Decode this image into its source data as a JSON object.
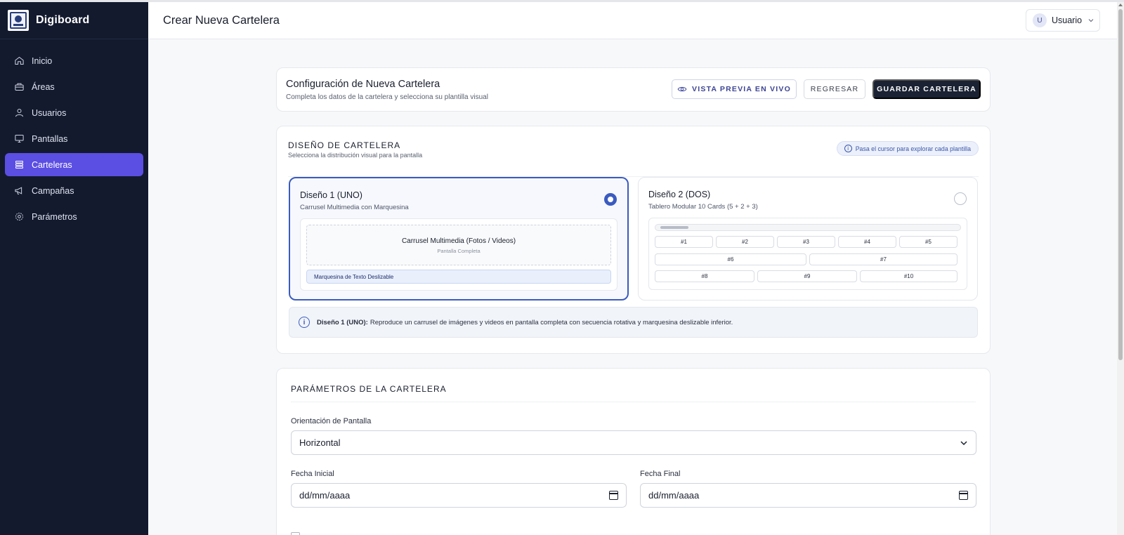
{
  "app": {
    "name": "Digiboard",
    "page_title": "Crear Nueva Cartelera"
  },
  "user": {
    "initial": "U",
    "name": "Usuario"
  },
  "sidebar": {
    "items": [
      {
        "label": "Inicio",
        "icon": "home-icon",
        "active": false
      },
      {
        "label": "Áreas",
        "icon": "briefcase-icon",
        "active": false
      },
      {
        "label": "Usuarios",
        "icon": "users-icon",
        "active": false
      },
      {
        "label": "Pantallas",
        "icon": "monitor-icon",
        "active": false
      },
      {
        "label": "Carteleras",
        "icon": "layers-icon",
        "active": true
      },
      {
        "label": "Campañas",
        "icon": "megaphone-icon",
        "active": false
      },
      {
        "label": "Parámetros",
        "icon": "gear-icon",
        "active": false
      }
    ]
  },
  "config": {
    "title": "Configuración de Nueva Cartelera",
    "subtitle": "Completa los datos de la cartelera y selecciona su plantilla visual",
    "preview_label": "VISTA PREVIA EN VIVO",
    "back_label": "REGRESAR",
    "save_label": "GUARDAR CARTELERA"
  },
  "design": {
    "title": "DISEÑO DE CARTELERA",
    "subtitle": "Selecciona la distribución visual para la pantalla",
    "hint": "Pasa el cursor para explorar cada plantilla",
    "options": [
      {
        "title": "Diseño 1 (UNO)",
        "subtitle": "Carrusel Multimedia con Marquesina",
        "selected": true,
        "carousel_title": "Carrusel Multimedia (Fotos / Videos)",
        "carousel_sub": "Pantalla Completa",
        "marquee": "Marquesina de Texto Deslizable"
      },
      {
        "title": "Diseño 2 (DOS)",
        "subtitle": "Tablero Modular 10 Cards (5 + 2 + 3)",
        "selected": false,
        "cells": [
          "#1",
          "#2",
          "#3",
          "#4",
          "#5",
          "#6",
          "#7",
          "#8",
          "#9",
          "#10"
        ]
      }
    ],
    "info_bold": "Diseño 1 (UNO):",
    "info_text": "Reproduce un carrusel de imágenes y videos en pantalla completa con secuencia rotativa y marquesina deslizable inferior."
  },
  "params": {
    "title": "PARÁMETROS DE LA CARTELERA",
    "orientation_label": "Orientación de Pantalla",
    "orientation_value": "Horizontal",
    "start_label": "Fecha Inicial",
    "start_placeholder": "dd/mm/aaaa",
    "end_label": "Fecha Final",
    "end_placeholder": "dd/mm/aaaa"
  },
  "colors": {
    "sidebar_bg": "#131a2e",
    "accent": "#5b4ee3",
    "selected_border": "#3b5bbf",
    "primary_button": "#1a2233"
  }
}
